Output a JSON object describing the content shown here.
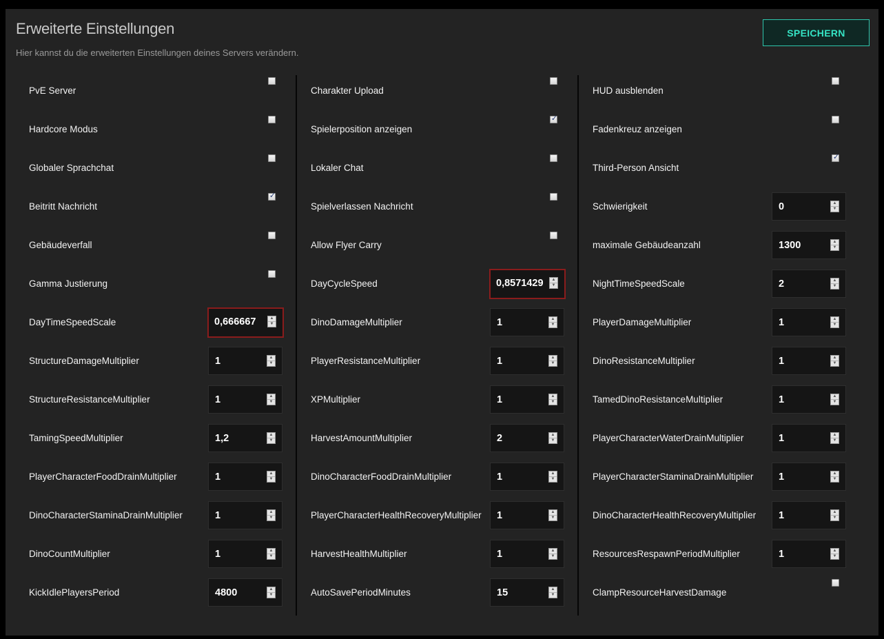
{
  "header": {
    "title": "Erweiterte Einstellungen",
    "subtitle": "Hier kannst du die erweiterten Einstellungen deines Servers verändern.",
    "save_label": "SPEICHERN"
  },
  "colors": {
    "accent": "#35e3c4",
    "highlight_border": "#8a1c1c",
    "panel_bg": "#232323"
  },
  "columns": [
    [
      {
        "label": "PvE Server",
        "type": "checkbox",
        "checked": false
      },
      {
        "label": "Hardcore Modus",
        "type": "checkbox",
        "checked": false
      },
      {
        "label": "Globaler Sprachchat",
        "type": "checkbox",
        "checked": false
      },
      {
        "label": "Beitritt Nachricht",
        "type": "checkbox",
        "checked": true
      },
      {
        "label": "Gebäudeverfall",
        "type": "checkbox",
        "checked": false
      },
      {
        "label": "Gamma Justierung",
        "type": "checkbox",
        "checked": false
      },
      {
        "label": "DayTimeSpeedScale",
        "type": "number",
        "value": "0,666667",
        "highlighted": true
      },
      {
        "label": "StructureDamageMultiplier",
        "type": "number",
        "value": "1"
      },
      {
        "label": "StructureResistanceMultiplier",
        "type": "number",
        "value": "1"
      },
      {
        "label": "TamingSpeedMultiplier",
        "type": "number",
        "value": "1,2"
      },
      {
        "label": "PlayerCharacterFoodDrainMultiplier",
        "type": "number",
        "value": "1"
      },
      {
        "label": "DinoCharacterStaminaDrainMultiplier",
        "type": "number",
        "value": "1"
      },
      {
        "label": "DinoCountMultiplier",
        "type": "number",
        "value": "1"
      },
      {
        "label": "KickIdlePlayersPeriod",
        "type": "number",
        "value": "4800"
      }
    ],
    [
      {
        "label": "Charakter Upload",
        "type": "checkbox",
        "checked": false
      },
      {
        "label": "Spielerposition anzeigen",
        "type": "checkbox",
        "checked": true
      },
      {
        "label": "Lokaler Chat",
        "type": "checkbox",
        "checked": false
      },
      {
        "label": "Spielverlassen Nachricht",
        "type": "checkbox",
        "checked": false
      },
      {
        "label": "Allow Flyer Carry",
        "type": "checkbox",
        "checked": false
      },
      {
        "label": "DayCycleSpeed",
        "type": "number",
        "value": "0,8571429",
        "highlighted": true
      },
      {
        "label": "DinoDamageMultiplier",
        "type": "number",
        "value": "1"
      },
      {
        "label": "PlayerResistanceMultiplier",
        "type": "number",
        "value": "1"
      },
      {
        "label": "XPMultiplier",
        "type": "number",
        "value": "1"
      },
      {
        "label": "HarvestAmountMultiplier",
        "type": "number",
        "value": "2"
      },
      {
        "label": "DinoCharacterFoodDrainMultiplier",
        "type": "number",
        "value": "1"
      },
      {
        "label": "PlayerCharacterHealthRecoveryMultiplier",
        "type": "number",
        "value": "1"
      },
      {
        "label": "HarvestHealthMultiplier",
        "type": "number",
        "value": "1"
      },
      {
        "label": "AutoSavePeriodMinutes",
        "type": "number",
        "value": "15"
      }
    ],
    [
      {
        "label": "HUD ausblenden",
        "type": "checkbox",
        "checked": false
      },
      {
        "label": "Fadenkreuz anzeigen",
        "type": "checkbox",
        "checked": false
      },
      {
        "label": "Third-Person Ansicht",
        "type": "checkbox",
        "checked": true
      },
      {
        "label": "Schwierigkeit",
        "type": "number",
        "value": "0"
      },
      {
        "label": "maximale Gebäudeanzahl",
        "type": "number",
        "value": "1300"
      },
      {
        "label": "NightTimeSpeedScale",
        "type": "number",
        "value": "2"
      },
      {
        "label": "PlayerDamageMultiplier",
        "type": "number",
        "value": "1"
      },
      {
        "label": "DinoResistanceMultiplier",
        "type": "number",
        "value": "1"
      },
      {
        "label": "TamedDinoResistanceMultiplier",
        "type": "number",
        "value": "1"
      },
      {
        "label": "PlayerCharacterWaterDrainMultiplier",
        "type": "number",
        "value": "1"
      },
      {
        "label": "PlayerCharacterStaminaDrainMultiplier",
        "type": "number",
        "value": "1"
      },
      {
        "label": "DinoCharacterHealthRecoveryMultiplier",
        "type": "number",
        "value": "1"
      },
      {
        "label": "ResourcesRespawnPeriodMultiplier",
        "type": "number",
        "value": "1"
      },
      {
        "label": "ClampResourceHarvestDamage",
        "type": "checkbox",
        "checked": false
      }
    ]
  ]
}
